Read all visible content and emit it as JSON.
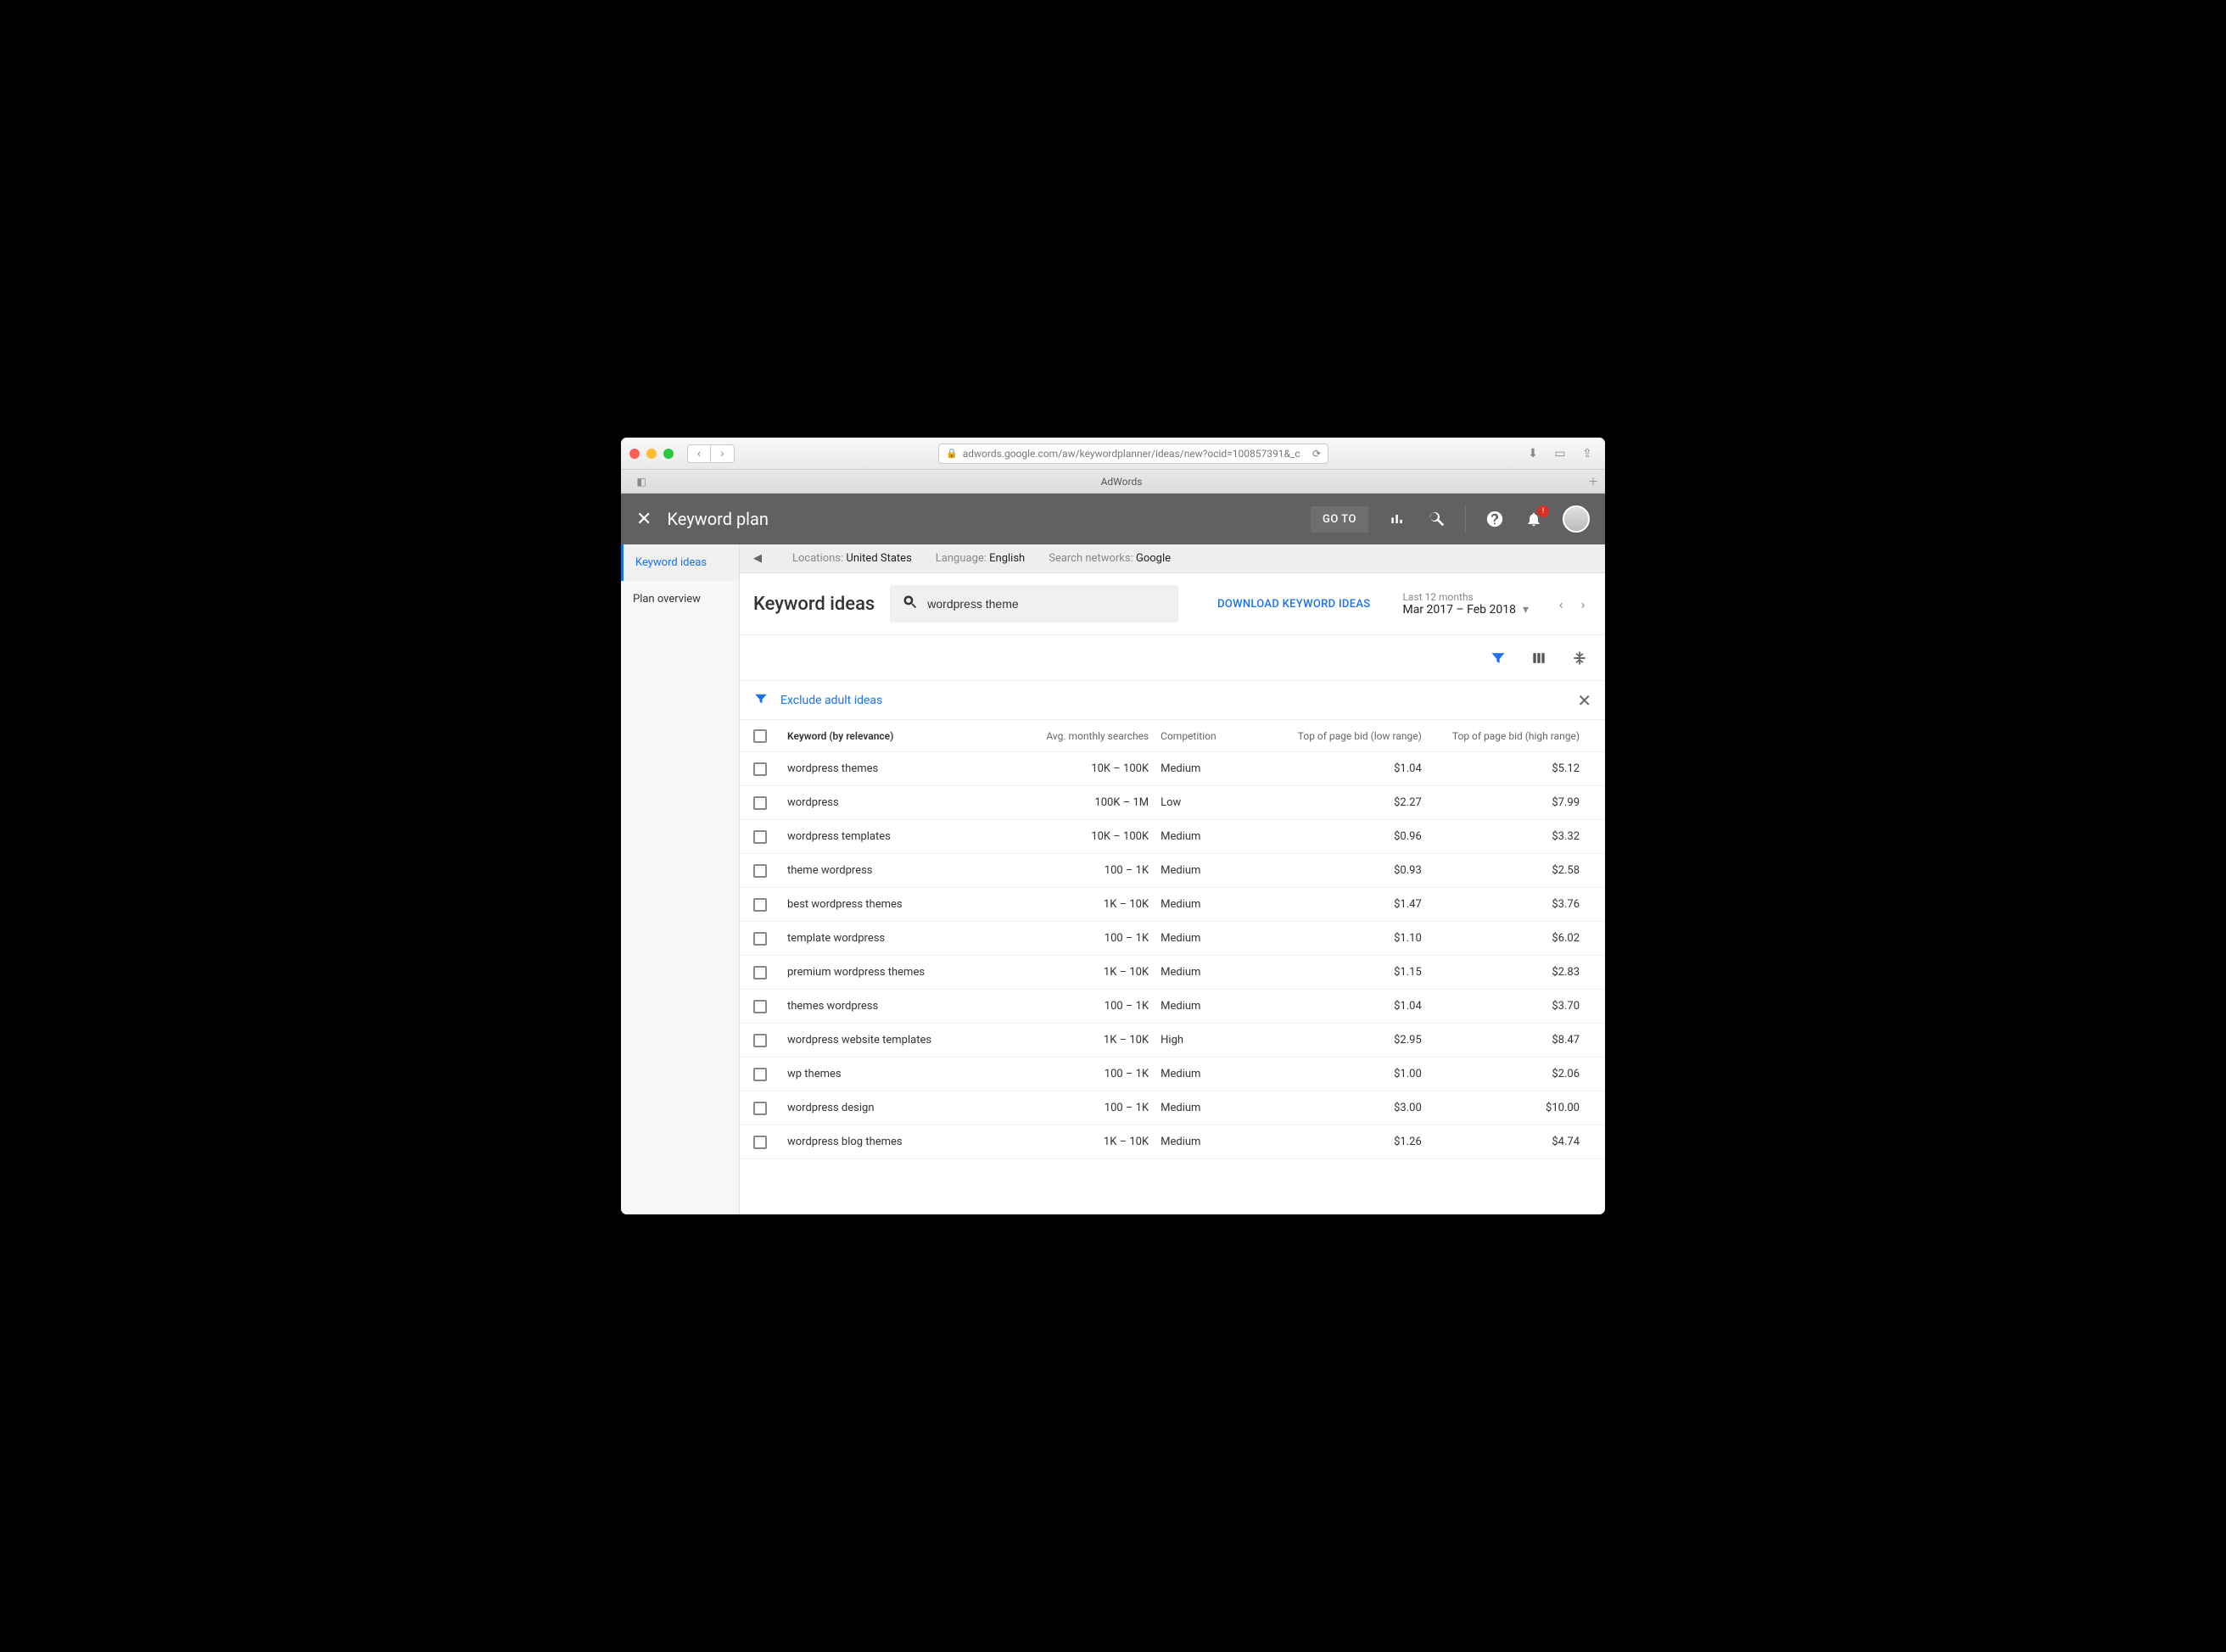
{
  "browser": {
    "url": "adwords.google.com/aw/keywordplanner/ideas/new?ocid=100857391&_c",
    "tab_title": "AdWords"
  },
  "header": {
    "title": "Keyword plan",
    "goto": "GO TO"
  },
  "sidebar": {
    "items": [
      "Keyword ideas",
      "Plan overview"
    ]
  },
  "targeting": {
    "locations_lbl": "Locations:",
    "locations_val": "United States",
    "language_lbl": "Language:",
    "language_val": "English",
    "networks_lbl": "Search networks:",
    "networks_val": "Google"
  },
  "titlebar": {
    "heading": "Keyword ideas",
    "search_value": "wordpress theme",
    "download": "DOWNLOAD KEYWORD IDEAS",
    "date_lbl": "Last 12 months",
    "date_val": "Mar 2017 – Feb 2018"
  },
  "filter": {
    "chip": "Exclude adult ideas"
  },
  "table": {
    "headers": {
      "keyword": "Keyword (by relevance)",
      "searches": "Avg. monthly searches",
      "competition": "Competition",
      "low": "Top of page bid (low range)",
      "high": "Top of page bid (high range)"
    },
    "rows": [
      {
        "kw": "wordpress themes",
        "searches": "10K – 100K",
        "comp": "Medium",
        "low": "$1.04",
        "high": "$5.12"
      },
      {
        "kw": "wordpress",
        "searches": "100K – 1M",
        "comp": "Low",
        "low": "$2.27",
        "high": "$7.99"
      },
      {
        "kw": "wordpress templates",
        "searches": "10K – 100K",
        "comp": "Medium",
        "low": "$0.96",
        "high": "$3.32"
      },
      {
        "kw": "theme wordpress",
        "searches": "100 – 1K",
        "comp": "Medium",
        "low": "$0.93",
        "high": "$2.58"
      },
      {
        "kw": "best wordpress themes",
        "searches": "1K – 10K",
        "comp": "Medium",
        "low": "$1.47",
        "high": "$3.76"
      },
      {
        "kw": "template wordpress",
        "searches": "100 – 1K",
        "comp": "Medium",
        "low": "$1.10",
        "high": "$6.02"
      },
      {
        "kw": "premium wordpress themes",
        "searches": "1K – 10K",
        "comp": "Medium",
        "low": "$1.15",
        "high": "$2.83"
      },
      {
        "kw": "themes wordpress",
        "searches": "100 – 1K",
        "comp": "Medium",
        "low": "$1.04",
        "high": "$3.70"
      },
      {
        "kw": "wordpress website templates",
        "searches": "1K – 10K",
        "comp": "High",
        "low": "$2.95",
        "high": "$8.47"
      },
      {
        "kw": "wp themes",
        "searches": "100 – 1K",
        "comp": "Medium",
        "low": "$1.00",
        "high": "$2.06"
      },
      {
        "kw": "wordpress design",
        "searches": "100 – 1K",
        "comp": "Medium",
        "low": "$3.00",
        "high": "$10.00"
      },
      {
        "kw": "wordpress blog themes",
        "searches": "1K – 10K",
        "comp": "Medium",
        "low": "$1.26",
        "high": "$4.74"
      }
    ]
  }
}
